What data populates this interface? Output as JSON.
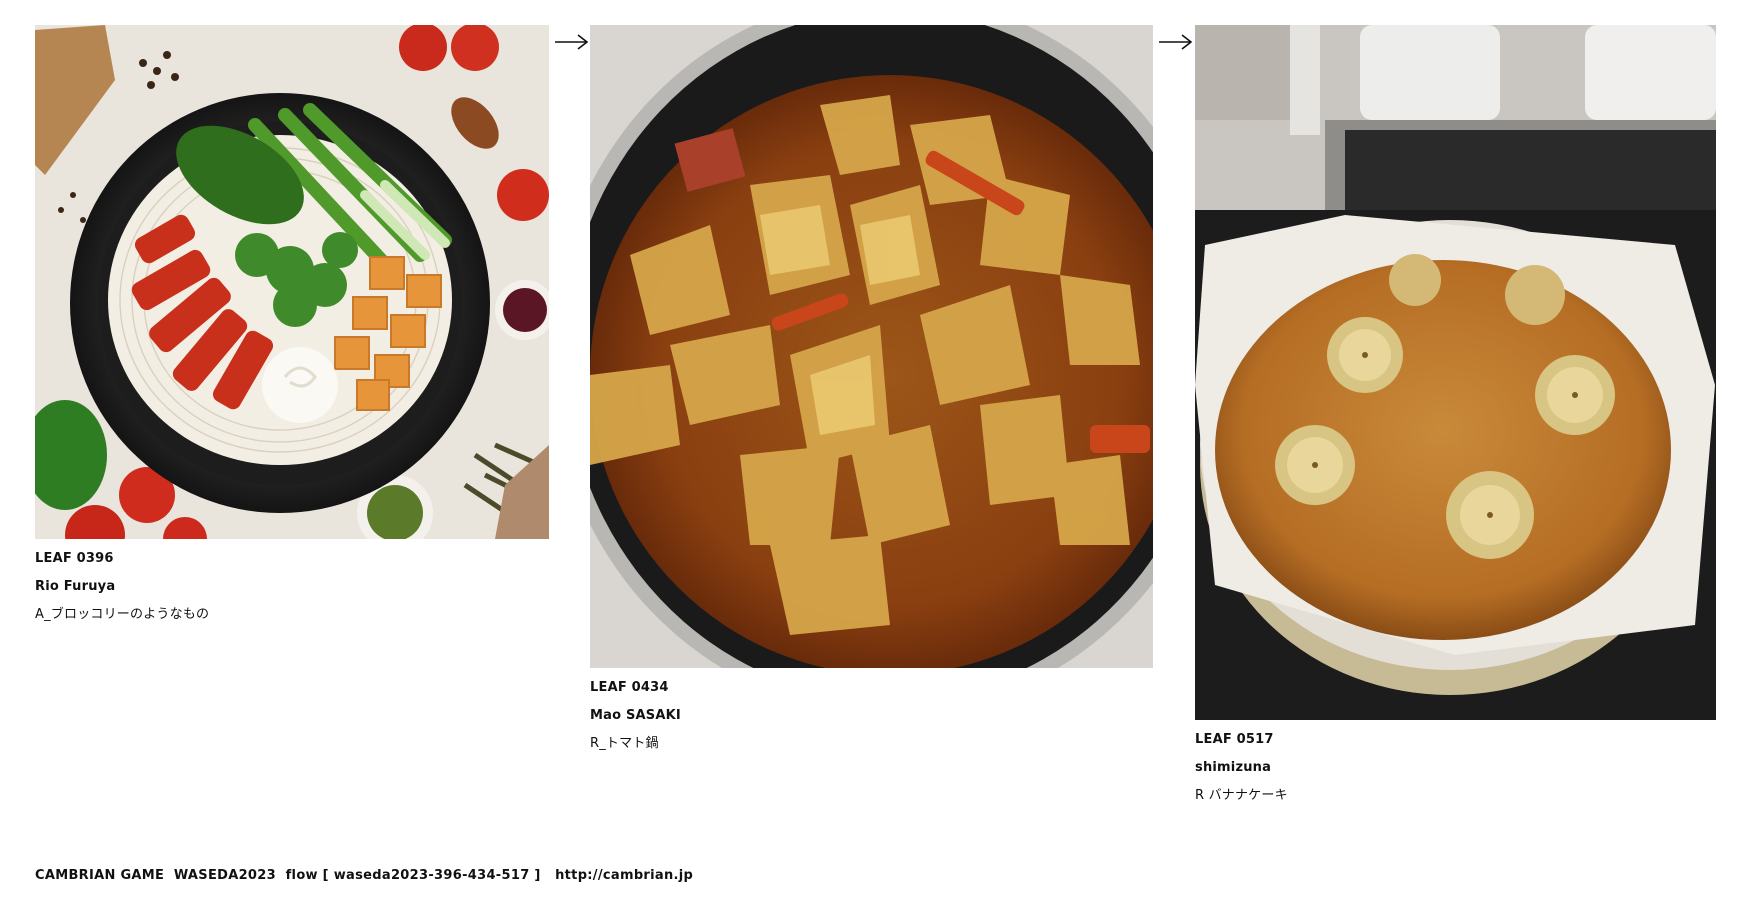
{
  "leaves": [
    {
      "code": "LEAF 0396",
      "author": "Rio Furuya",
      "title": "A_ブロッコリーのようなもの",
      "image": "noodle bowl with broccoli, leek, carrot, tofu, cream and spices"
    },
    {
      "code": "LEAF 0434",
      "author": "Mao SASAKI",
      "title": "R_トマト鍋",
      "image": "tomato hot pot with cabbage and carrot"
    },
    {
      "code": "LEAF 0517",
      "author": "shimizuna",
      "title": "R バナナケーキ",
      "image": "banana cake baked in a round tin"
    }
  ],
  "arrows": [
    "→",
    "→"
  ],
  "footer": {
    "label": "CAMBRIAN GAME  WASEDA2023  flow [ waseda2023-396-434-517 ]",
    "link": "http://cambrian.jp"
  },
  "colors": {
    "text": "#111111",
    "background": "#ffffff"
  }
}
